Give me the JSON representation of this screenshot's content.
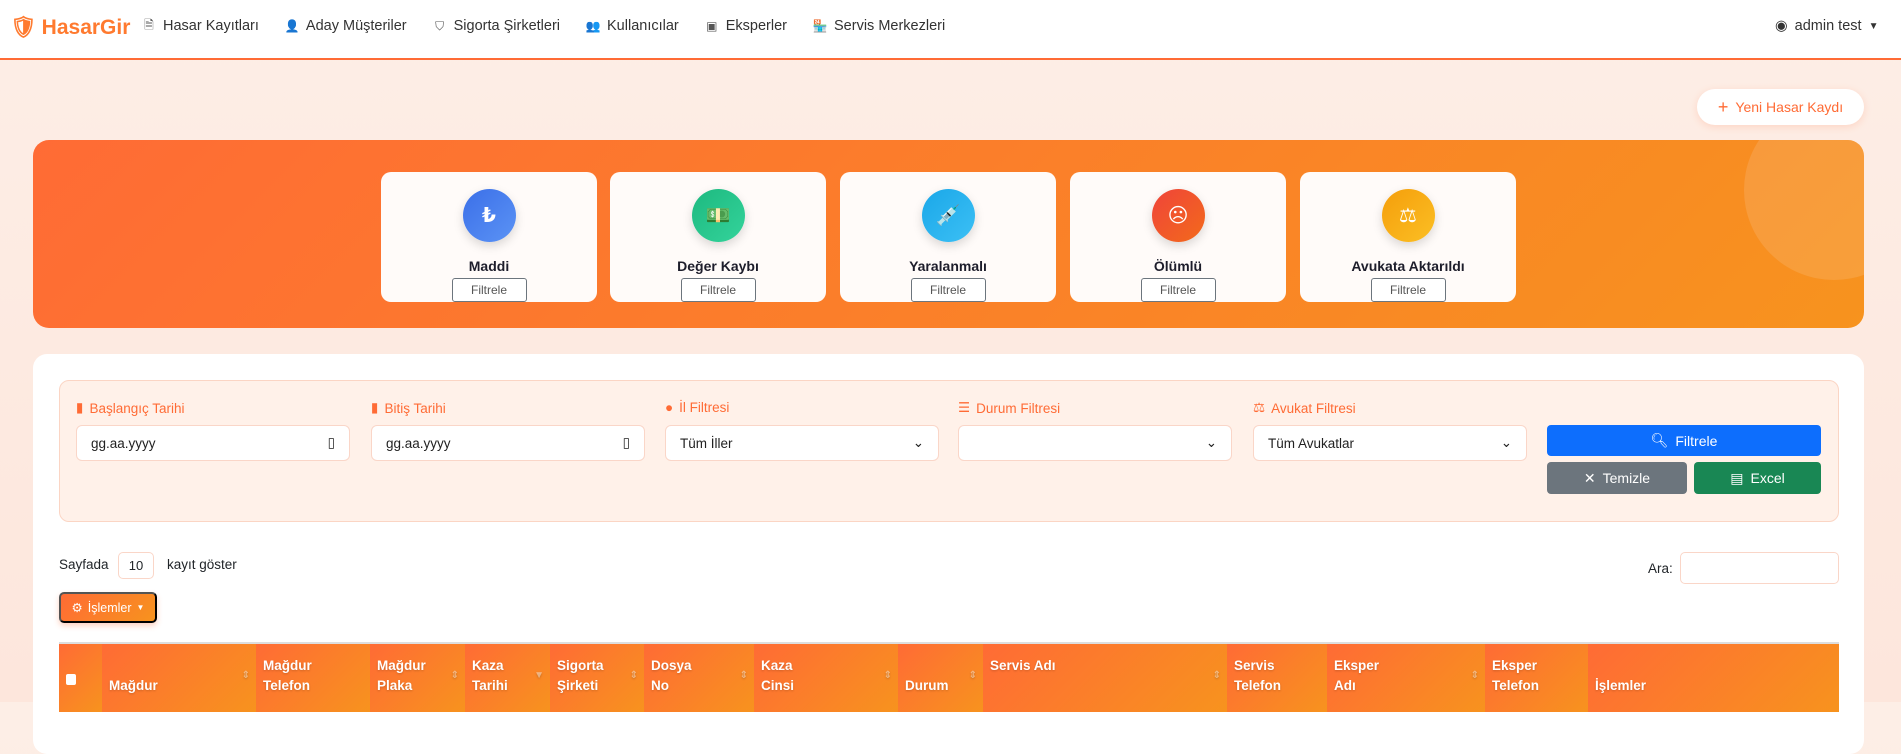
{
  "nav": {
    "brand": "HasarGir",
    "items": [
      {
        "label": "Hasar Kayıtları",
        "icon": "file-icon"
      },
      {
        "label": "Aday Müşteriler",
        "icon": "user-plus-icon"
      },
      {
        "label": "Sigorta Şirketleri",
        "icon": "shield-icon"
      },
      {
        "label": "Kullanıcılar",
        "icon": "users-icon"
      },
      {
        "label": "Eksperler",
        "icon": "badge-icon"
      },
      {
        "label": "Servis Merkezleri",
        "icon": "shop-icon"
      }
    ],
    "user": "admin test"
  },
  "new_button": "Yeni Hasar Kaydı",
  "cards": [
    {
      "title": "Maddi",
      "button": "Filtrele",
      "glyph": "₺",
      "color": "#3b6fe8"
    },
    {
      "title": "Değer Kaybı",
      "button": "Filtrele",
      "glyph": "💵",
      "color": "#22c08a"
    },
    {
      "title": "Yaralanmalı",
      "button": "Filtrele",
      "glyph": "💉",
      "color": "#1faee9"
    },
    {
      "title": "Ölümlü",
      "button": "Filtrele",
      "glyph": "☹",
      "color": "#f04e3a"
    },
    {
      "title": "Avukata Aktarıldı",
      "button": "Filtrele",
      "glyph": "⚖",
      "color": "#f5a30f"
    }
  ],
  "filters": {
    "start_label": "Başlangıç Tarihi",
    "start_value": "gg.aa.yyyy",
    "end_label": "Bitiş Tarihi",
    "end_value": "gg.aa.yyyy",
    "city_label": "İl Filtresi",
    "city_value": "Tüm İller",
    "status_label": "Durum Filtresi",
    "status_value": "",
    "lawyer_label": "Avukat Filtresi",
    "lawyer_value": "Tüm Avukatlar",
    "filter_btn": "Filtrele",
    "clear_btn": "Temizle",
    "excel_btn": "Excel"
  },
  "table_controls": {
    "show_prefix": "Sayfada",
    "page_size": "10",
    "show_suffix": "kayıt göster",
    "search_label": "Ara:",
    "actions": "İşlemler"
  },
  "columns": [
    "",
    "Mağdur",
    "Mağdur Telefon",
    "Mağdur Plaka",
    "Kaza Tarihi",
    "Sigorta Şirketi",
    "Dosya No",
    "Kaza Cinsi",
    "Durum",
    "Servis Adı",
    "Servis Telefon",
    "Eksper Adı",
    "Eksper Telefon",
    "İşlemler"
  ]
}
